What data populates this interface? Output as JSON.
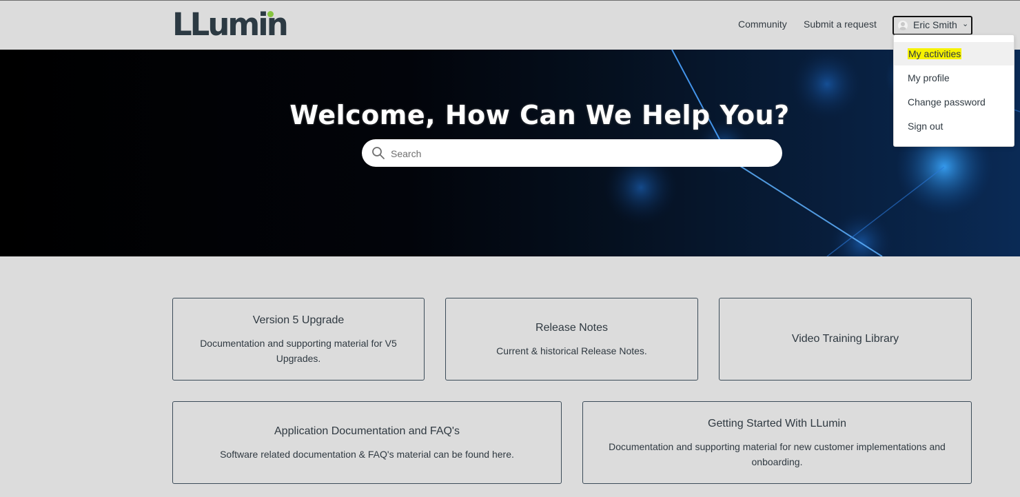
{
  "header": {
    "logo_text": "LLumin",
    "nav": {
      "community": "Community",
      "submit_request": "Submit a request"
    },
    "user": {
      "name": "Eric Smith",
      "chevron": "⌄",
      "avatar_icon": "user-avatar-icon"
    }
  },
  "user_menu": {
    "items": [
      {
        "label": "My activities",
        "highlighted": true
      },
      {
        "label": "My profile"
      },
      {
        "label": "Change password"
      },
      {
        "label": "Sign out"
      }
    ]
  },
  "hero": {
    "title": "Welcome, How Can We Help You?",
    "search_placeholder": "Search",
    "search_icon": "search-icon"
  },
  "cards": [
    {
      "title": "Version 5 Upgrade",
      "description": "Documentation and supporting material for V5 Upgrades."
    },
    {
      "title": "Release Notes",
      "description": "Current & historical Release Notes."
    },
    {
      "title": "Video Training Library",
      "description": ""
    },
    {
      "title": "Application Documentation and FAQ's",
      "description": "Software related documentation & FAQ's material can be found here."
    },
    {
      "title": "Getting Started With LLumin",
      "description": "Documentation and supporting material for new customer implementations and onboarding."
    }
  ],
  "colors": {
    "background": "#dcdcdc",
    "text": "#2f3941",
    "card_border": "#3a4a57",
    "logo_dot": "#86c440",
    "highlight": "#f6f200"
  }
}
